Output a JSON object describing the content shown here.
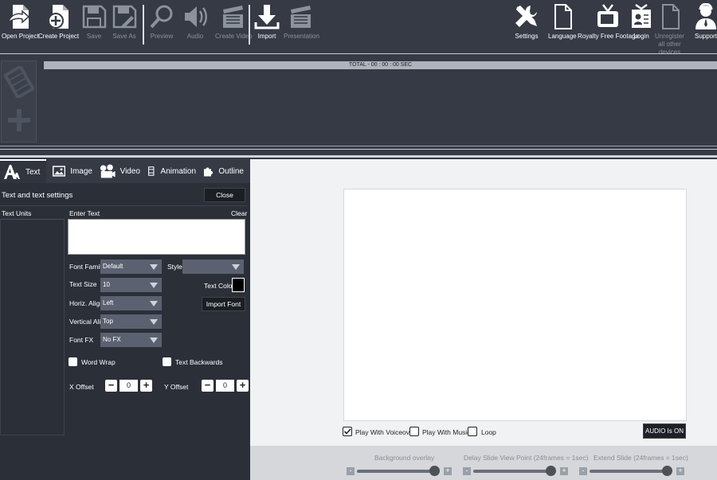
{
  "toolbar": {
    "open_project": "Open Project",
    "create_project": "Create Project",
    "save": "Save",
    "save_as": "Save As",
    "preview": "Preview",
    "audio": "Audio",
    "create_video": "Create Video",
    "import": "Import",
    "presentation": "Presentation",
    "settings": "Settings",
    "language": "Language",
    "royalty_free": "Royalty Free Footage",
    "login": "Login",
    "unregister": "Unregister all other devices",
    "support": "Support"
  },
  "timeline": {
    "total": "TOTAL - 00 : 00 : 00 SEC"
  },
  "tabs": {
    "text": "Text",
    "image": "Image",
    "video": "Video",
    "animation": "Animation",
    "outline": "Outline"
  },
  "text_panel": {
    "title": "Text and text settings",
    "close": "Close",
    "text_units": "Text Units",
    "enter_text": "Enter Text",
    "clear": "Clear",
    "font_family_label": "Font Family",
    "font_family_value": "Default",
    "style_label": "Style",
    "style_value": "",
    "text_size_label": "Text Size",
    "text_size_value": "10",
    "text_color_label": "Text Color",
    "horiz_align_label": "Horiz. Align",
    "horiz_align_value": "Left",
    "import_font": "Import Font",
    "vertical_align_label": "Vertical Align",
    "vertical_align_value": "Top",
    "font_fx_label": "Font FX",
    "font_fx_value": "No FX",
    "word_wrap": "Word Wrap",
    "text_backwards": "Text Backwards",
    "x_offset_label": "X Offset",
    "x_offset_value": "0",
    "y_offset_label": "Y Offset",
    "y_offset_value": "0",
    "text_color": "#000000"
  },
  "preview": {
    "play_with_voiceover": "Play With Voiceover",
    "voiceover_checked": true,
    "play_with_music": "Play With Music",
    "loop": "Loop",
    "audio_button": "AUDIO Is ON"
  },
  "sliders": {
    "background_overlay": "Background overlay",
    "delay_slide": "Delay Slide View Point (24frames = 1sec)",
    "extend_slide": "Extend Slide (24frames = 1sec)"
  }
}
